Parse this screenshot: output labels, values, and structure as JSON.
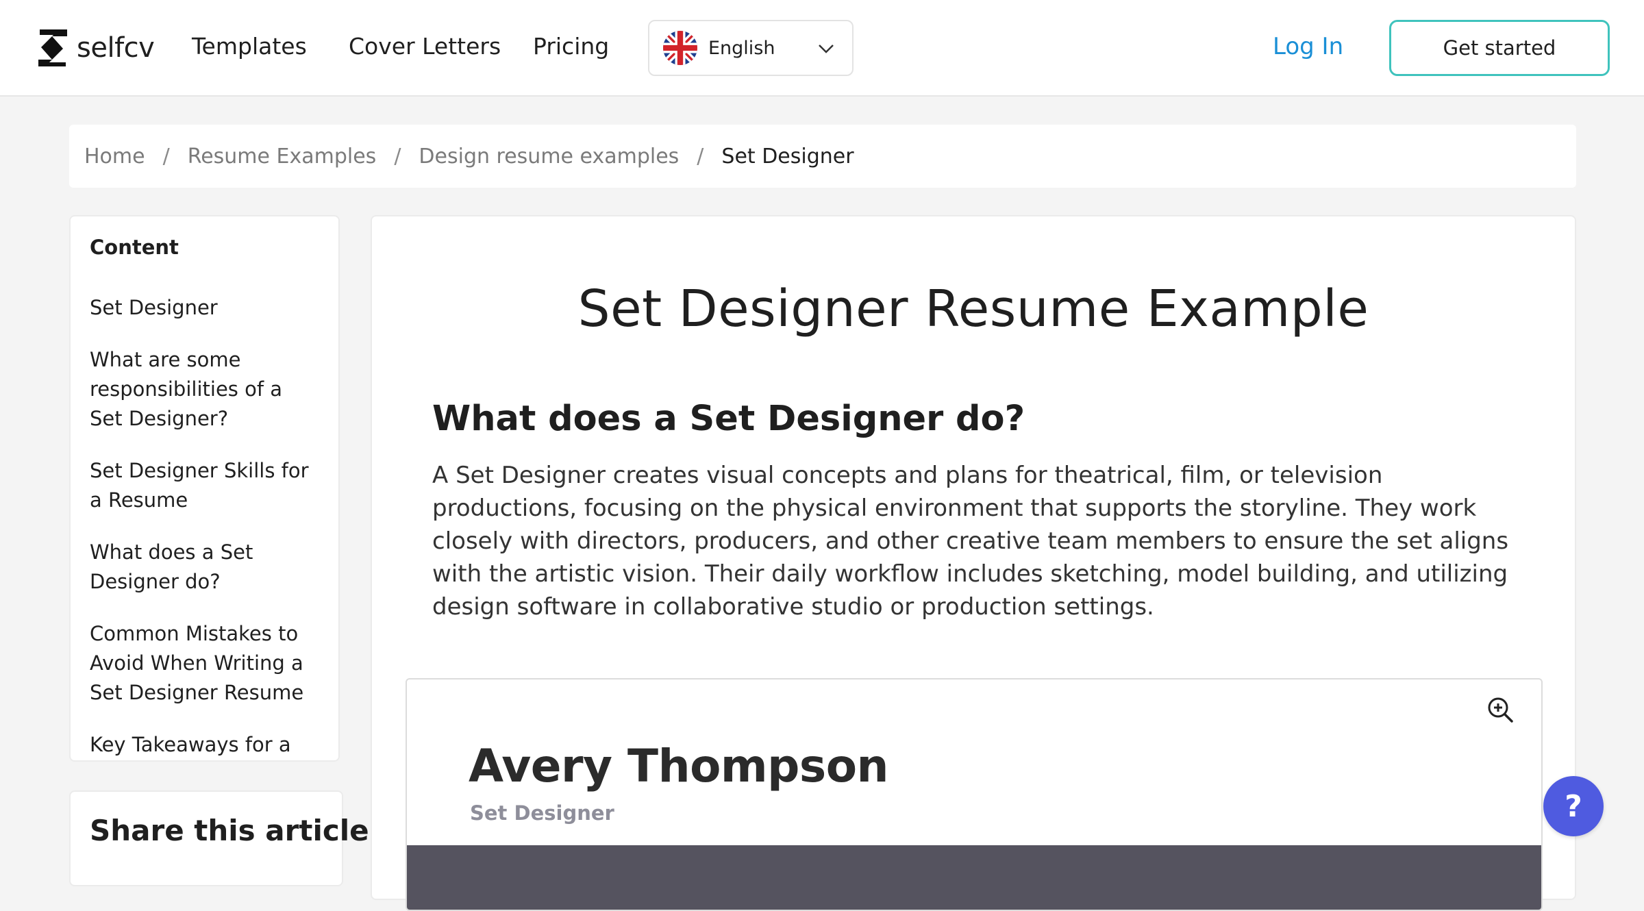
{
  "header": {
    "logo_text": "selfcv",
    "nav": [
      {
        "label": "Templates"
      },
      {
        "label": "Cover Letters"
      },
      {
        "label": "Pricing"
      }
    ],
    "language": {
      "label": "English",
      "flag_icon": "uk-flag-icon"
    },
    "login_label": "Log In",
    "cta_label": "Get started",
    "accent_color": "#3fc3bd",
    "link_color": "#1a8fd6"
  },
  "breadcrumb": {
    "items": [
      "Home",
      "Resume Examples",
      "Design resume examples"
    ],
    "separator": "/",
    "current": "Set Designer"
  },
  "toc": {
    "title": "Content",
    "items": [
      "Set Designer",
      "What are some responsibilities of a Set Designer?",
      "Set Designer Skills for a Resume",
      "What does a Set Designer do?",
      "Common Mistakes to Avoid When Writing a Set Designer Resume",
      "Key Takeaways for a"
    ]
  },
  "share": {
    "title": "Share this article"
  },
  "main": {
    "title": "Set Designer Resume Example",
    "section_heading": "What does a Set Designer do?",
    "section_body": "A Set Designer creates visual concepts and plans for theatrical, film, or television productions, focusing on the physical environment that supports the storyline. They work closely with directors, producers, and other creative team members to ensure the set aligns with the artistic vision. Their daily workflow includes sketching, model building, and utilizing design software in collaborative studio or production settings."
  },
  "resume_preview": {
    "name": "Avery Thompson",
    "role": "Set Designer",
    "zoom_icon": "zoom-in-icon",
    "band_color": "#55535f"
  },
  "help_button": {
    "label": "?",
    "color": "#4f5be0"
  }
}
